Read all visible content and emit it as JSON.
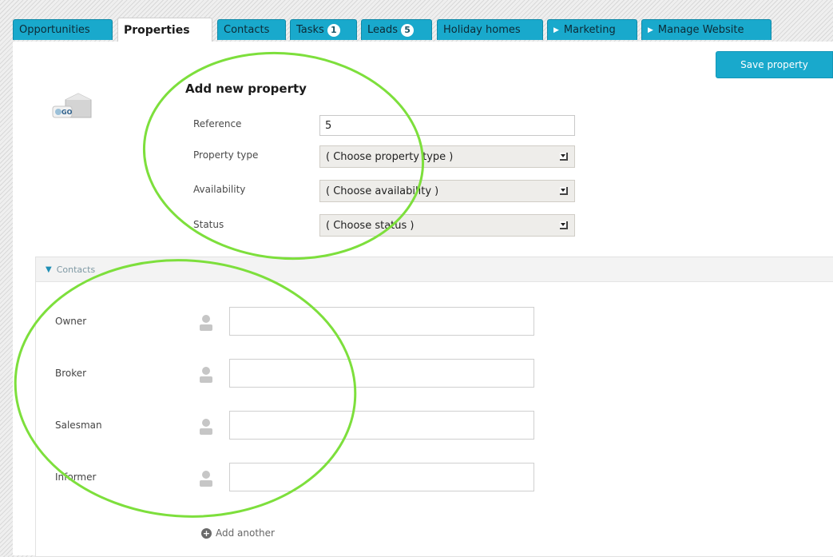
{
  "tabs": [
    {
      "label": "Opportunities"
    },
    {
      "label": "Properties"
    },
    {
      "label": "Contacts"
    },
    {
      "label": "Tasks",
      "badge": "1"
    },
    {
      "label": "Leads",
      "badge": "5"
    },
    {
      "label": "Holiday homes"
    },
    {
      "label": "Marketing"
    },
    {
      "label": "Manage Website"
    }
  ],
  "toolbar": {
    "save_label": "Save property"
  },
  "logo": {
    "text": "GO"
  },
  "form": {
    "title": "Add new property",
    "reference_label": "Reference",
    "reference_value": "5",
    "property_type_label": "Property type",
    "property_type_value": "( Choose property type )",
    "availability_label": "Availability",
    "availability_value": "( Choose availability )",
    "status_label": "Status",
    "status_value": "( Choose status )"
  },
  "contacts": {
    "header": "Contacts",
    "rows": [
      {
        "label": "Owner"
      },
      {
        "label": "Broker"
      },
      {
        "label": "Salesman"
      },
      {
        "label": "Informer"
      }
    ],
    "add_another": "Add another"
  },
  "colors": {
    "accent": "#19a9cc",
    "annotation": "#7ddf3c"
  }
}
